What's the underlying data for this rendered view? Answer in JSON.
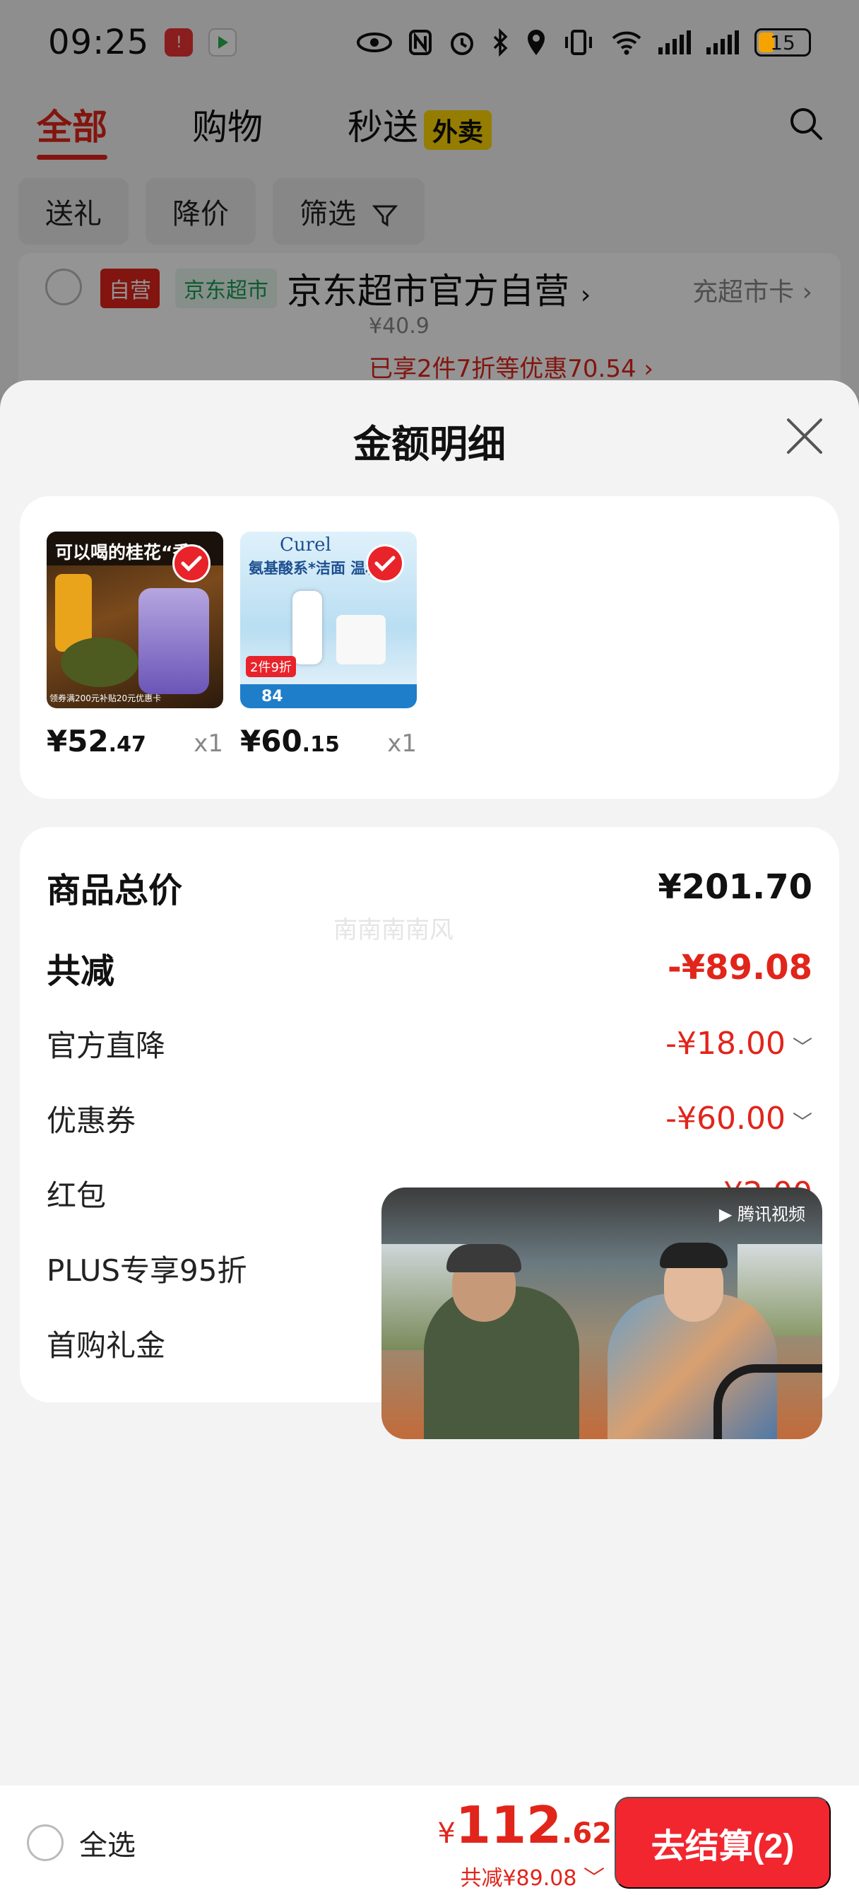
{
  "status_bar": {
    "time": "09:25",
    "battery": "15"
  },
  "tabs": [
    {
      "label": "全部"
    },
    {
      "label": "购物"
    },
    {
      "label": "秒送",
      "badge": "外卖"
    }
  ],
  "chips": [
    "送礼",
    "降价",
    "筛选"
  ],
  "store": {
    "tag_self": "自营",
    "tag_market": "京东超市",
    "name": "京东超市官方自营",
    "link": "充超市卡",
    "partial_price": "¥40.9",
    "promo": "已享2件7折等优惠70.54"
  },
  "sheet": {
    "title": "金额明细",
    "products": [
      {
        "price_int": "¥52",
        "price_dec": ".47",
        "qty": "x1",
        "img_title": "可以喝的桂花“香”",
        "img_caption": "领券满200元补贴20元优惠卡"
      },
      {
        "price_int": "¥60",
        "price_dec": ".15",
        "qty": "x1",
        "img_title": "氨基酸系*洁面 温和洗",
        "img_brand": "Curel",
        "img_badge": "2件9折",
        "img_price": "84"
      }
    ],
    "details": {
      "total_label": "商品总价",
      "total_value": "¥201.70",
      "reduce_label": "共减",
      "reduce_value": "-¥89.08",
      "watermark": "南南南南风",
      "items": [
        {
          "label": "官方直降",
          "value": "-¥18.00"
        },
        {
          "label": "优惠券",
          "value": "-¥60.00"
        },
        {
          "label": "红包",
          "value": "-¥2.00"
        },
        {
          "label": "PLUS专享95折",
          "value": ""
        },
        {
          "label": "首购礼金",
          "value": ""
        }
      ]
    },
    "video_brand": "腾讯视频"
  },
  "bottom_bar": {
    "select_all": "全选",
    "total_yen": "¥",
    "total_int": "112",
    "total_dec": ".62",
    "total_sub": "共减¥89.08",
    "checkout": "去结算(2)"
  },
  "colors": {
    "accent": "#e1251b",
    "checkout": "#f2262f"
  }
}
